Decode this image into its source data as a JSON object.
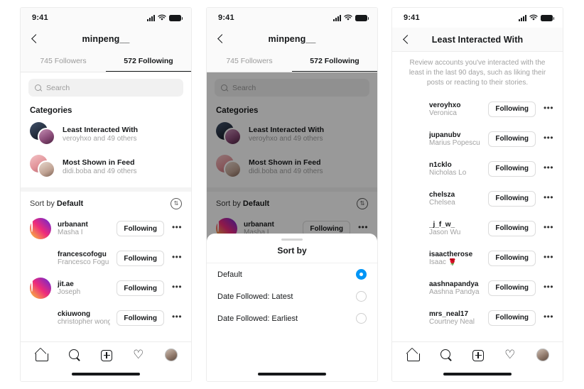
{
  "status": {
    "time": "9:41",
    "signal_icon": "signal-bars-icon",
    "wifi_icon": "wifi-icon",
    "battery_icon": "battery-icon"
  },
  "phone1": {
    "nav": {
      "back_icon": "back-chevron-icon",
      "title": "minpeng__"
    },
    "tabs": [
      {
        "label": "745 Followers",
        "active": false
      },
      {
        "label": "572 Following",
        "active": true
      }
    ],
    "search": {
      "placeholder": "Search",
      "icon": "search-icon"
    },
    "categories_label": "Categories",
    "categories": [
      {
        "title": "Least Interacted With",
        "subtitle": "veroyhxo and 49 others"
      },
      {
        "title": "Most Shown in Feed",
        "subtitle": "didi.boba and 49 others"
      }
    ],
    "sort": {
      "prefix": "Sort by ",
      "value": "Default",
      "icon": "sort-arrows-icon"
    },
    "users": [
      {
        "username": "urbanant",
        "fullname": "Masha I",
        "button": "Following",
        "ring": true
      },
      {
        "username": "francescofogu",
        "fullname": "Francesco Fogu",
        "button": "Following",
        "ring": false
      },
      {
        "username": "jit.ae",
        "fullname": "Joseph",
        "button": "Following",
        "ring": true
      },
      {
        "username": "ckiuwong",
        "fullname": "christopher wong",
        "button": "Following",
        "ring": false
      }
    ],
    "bottom_nav": [
      "home-icon",
      "search-icon",
      "new-post-icon",
      "heart-icon",
      "profile-avatar"
    ]
  },
  "phone2": {
    "nav": {
      "back_icon": "back-chevron-icon",
      "title": "minpeng__"
    },
    "tabs": [
      {
        "label": "745 Followers",
        "active": false
      },
      {
        "label": "572 Following",
        "active": true
      }
    ],
    "search": {
      "placeholder": "Search",
      "icon": "search-icon"
    },
    "categories_label": "Categories",
    "categories": [
      {
        "title": "Least Interacted With",
        "subtitle": "veroyhxo and 49 others"
      },
      {
        "title": "Most Shown in Feed",
        "subtitle": "didi.boba and 49 others"
      }
    ],
    "sort": {
      "prefix": "Sort by ",
      "value": "Default",
      "icon": "sort-arrows-icon"
    },
    "users": [
      {
        "username": "urbanant",
        "fullname": "Masha I",
        "button": "Following",
        "ring": true
      }
    ],
    "sheet": {
      "title": "Sort by",
      "options": [
        {
          "label": "Default",
          "selected": true
        },
        {
          "label": "Date Followed: Latest",
          "selected": false
        },
        {
          "label": "Date Followed: Earliest",
          "selected": false
        }
      ],
      "accent": "#0095f6"
    }
  },
  "phone3": {
    "nav": {
      "back_icon": "back-chevron-icon",
      "title": "Least Interacted With"
    },
    "description": "Review accounts you've interacted with the least in the last 90 days, such as liking their posts or reacting to their stories.",
    "users": [
      {
        "username": "veroyhxo",
        "fullname": "Veronica",
        "button": "Following"
      },
      {
        "username": "jupanubv",
        "fullname": "Marius Popescu",
        "button": "Following"
      },
      {
        "username": "n1cklo",
        "fullname": "Nicholas Lo",
        "button": "Following"
      },
      {
        "username": "chelsza",
        "fullname": "Chelsea",
        "button": "Following"
      },
      {
        "username": "_j_f_w_",
        "fullname": "Jason Wu",
        "button": "Following"
      },
      {
        "username": "isaactherose",
        "fullname": "Isaac 🌹",
        "button": "Following"
      },
      {
        "username": "aashnapandya",
        "fullname": "Aashna Pandya",
        "button": "Following"
      },
      {
        "username": "mrs_neal17",
        "fullname": "Courtney Neal",
        "button": "Following"
      }
    ],
    "bottom_nav": [
      "home-icon",
      "search-icon",
      "new-post-icon",
      "heart-icon",
      "profile-avatar"
    ]
  }
}
